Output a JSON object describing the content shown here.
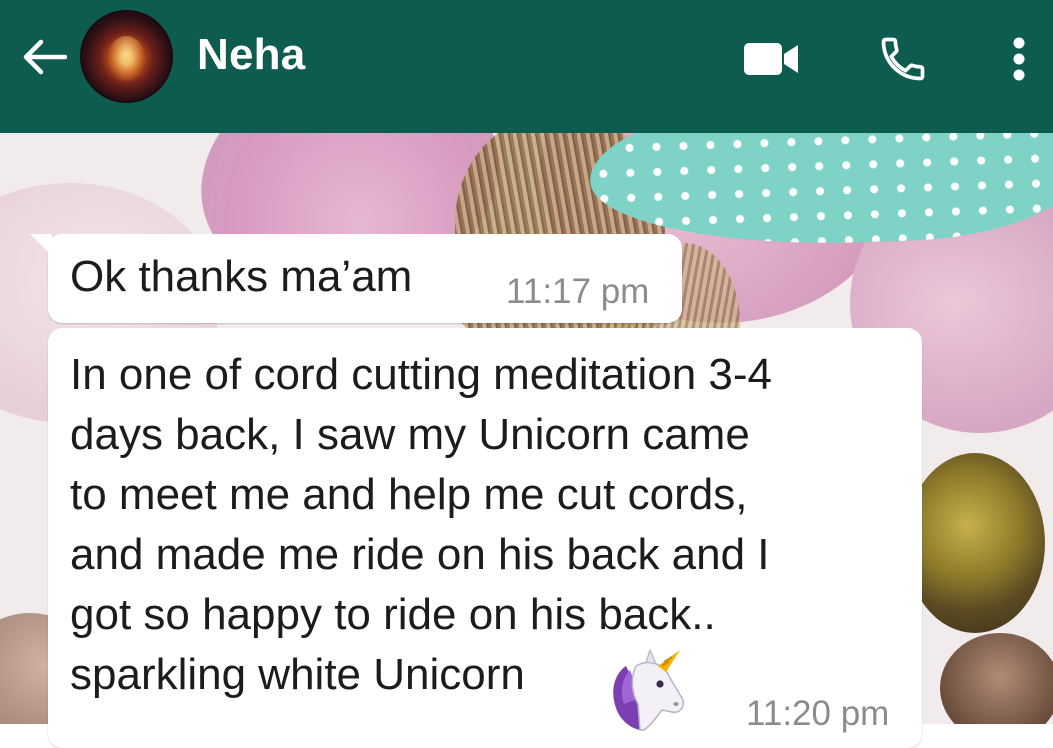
{
  "header": {
    "contact_name": "Neha",
    "background_color": "#0d5c4f",
    "icons": [
      "back-arrow-icon",
      "video-camera-icon",
      "phone-icon",
      "more-vertical-icon"
    ]
  },
  "messages": [
    {
      "lines": [
        "Ok thanks ma’am"
      ],
      "time": "11:17 pm"
    },
    {
      "lines": [
        "In one of cord cutting meditation 3-4",
        "days back, I saw my Unicorn came",
        "to meet me and help me cut cords,",
        "and made me ride on his back and I",
        "got so happy to ride on his back..",
        "sparkling white Unicorn"
      ],
      "emoji": "unicorn-icon",
      "time": "11:20 pm"
    }
  ],
  "colors": {
    "bubble": "#ffffff",
    "time_text": "#8c8c8c",
    "message_text": "#1c1c1c"
  }
}
